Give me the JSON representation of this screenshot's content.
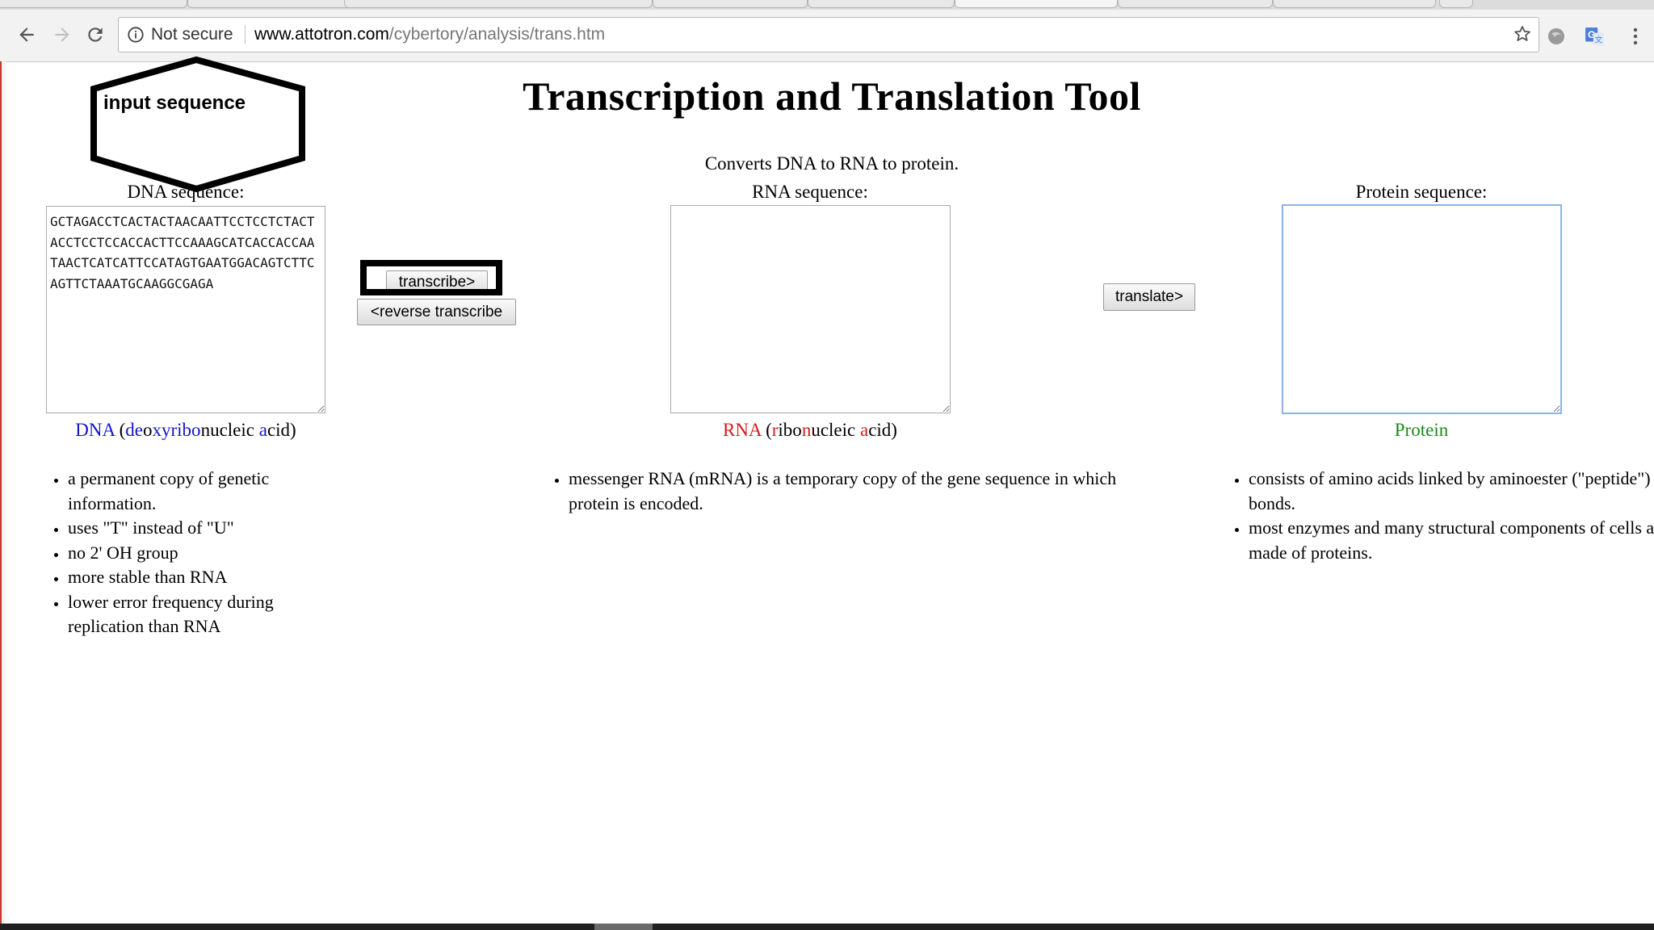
{
  "browser": {
    "security_label": "Not secure",
    "url_host": "www.attotron.com",
    "url_path": "/cybertory/analysis/trans.htm"
  },
  "page": {
    "title": "Transcription and Translation Tool",
    "subtitle": "Converts DNA to RNA to protein."
  },
  "annotation": {
    "label": "input sequence"
  },
  "dna": {
    "label": "DNA sequence:",
    "value": "GCTAGACCTCACTACTAACAATTCCTCCTCTACTACCTCCTCCACCACTTCCAAAGCATCACCACCAATAACTCATCATTCCATAGTGAATGGACAGTCTTCAGTTCTAAATGCAAGGCGAGA",
    "caption_abbr": "DNA",
    "caption_open": " (",
    "caption_p1": "de",
    "caption_p2": "o",
    "caption_p3": "xyribo",
    "caption_p4": "n",
    "caption_p5": "ucleic ",
    "caption_p6": "a",
    "caption_p7": "cid)",
    "bullets": [
      "a permanent copy of genetic information.",
      "uses \"T\" instead of \"U\"",
      "no 2' OH group",
      "more stable than RNA",
      "lower error frequency during replication than RNA"
    ]
  },
  "buttons": {
    "transcribe": "transcribe>",
    "reverse_transcribe": "<reverse transcribe",
    "translate": "translate>"
  },
  "rna": {
    "label": "RNA sequence:",
    "value": "",
    "caption_abbr": "RNA",
    "caption_open": " (",
    "caption_p1": "r",
    "caption_p2": "ibo",
    "caption_p3": "n",
    "caption_p4": "ucleic ",
    "caption_p5": "a",
    "caption_p6": "cid)",
    "bullets": [
      "messenger RNA (mRNA) is a temporary copy of the gene sequence in which protein is encoded."
    ]
  },
  "protein": {
    "label": "Protein sequence:",
    "value": "",
    "caption": "Protein",
    "bullets": [
      "consists of amino acids linked by aminoester (\"peptide\") bonds.",
      "most enzymes and many structural components of cells are made of proteins."
    ]
  },
  "colors": {
    "dna_accent": "#1414c8",
    "rna_accent": "#d51a1a",
    "protein_accent": "#1a8a1a",
    "focus_ring": "#8fb2e6"
  },
  "icons": [
    "back-arrow-icon",
    "forward-arrow-icon",
    "reload-icon",
    "info-icon",
    "star-icon",
    "extension-icon",
    "translate-extension-icon",
    "kebab-menu-icon"
  ]
}
